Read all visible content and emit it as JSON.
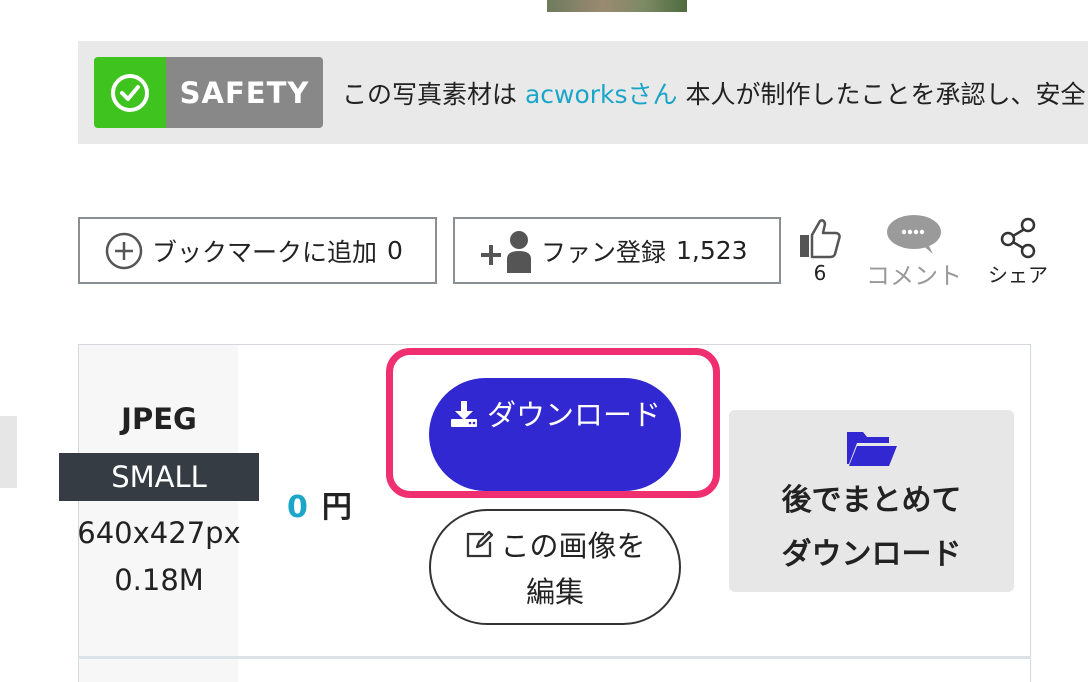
{
  "safety": {
    "badge_label": "SAFETY",
    "text_before": "この写真素材は",
    "author_link": "acworksさん",
    "text_after": "本人が制作したことを承認し、安全"
  },
  "actions": {
    "bookmark_label": "ブックマークに追加",
    "bookmark_count": "0",
    "fan_label": "ファン登録",
    "fan_count": "1,523",
    "like_count": "6",
    "comment_label": "コメント",
    "share_label": "シェア"
  },
  "download_option": {
    "format": "JPEG",
    "size": "SMALL",
    "dimensions": "640x427px",
    "file_size": "0.18M",
    "price_value": "0",
    "price_unit": "円",
    "download_label": "ダウンロード",
    "edit_label": "この画像を編集",
    "later_label_line1": "後でまとめて",
    "later_label_line2": "ダウンロード"
  },
  "colors": {
    "accent_blue": "#1aa5c9",
    "download_button": "#3228d1",
    "highlight": "#ef2f6f",
    "safety_green": "#3fc31f"
  }
}
